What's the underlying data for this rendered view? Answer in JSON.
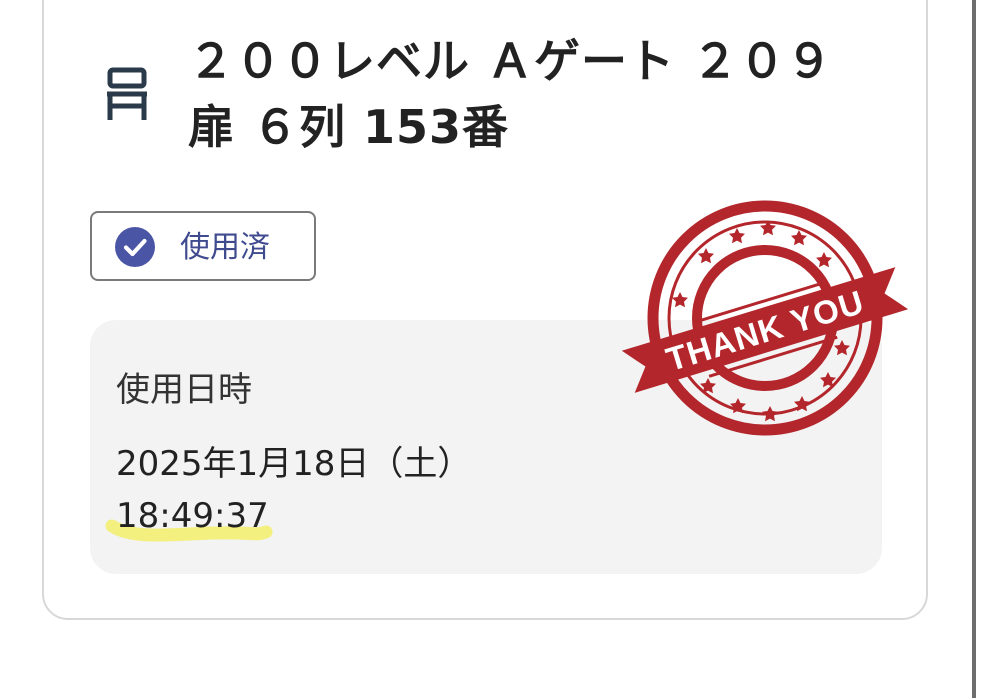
{
  "seat": {
    "title_line1": "２００レベル Ａゲート ２０９",
    "title_line2": "扉 ６列 153番",
    "icon": "seat-icon"
  },
  "status": {
    "label": "使用済",
    "icon": "check-circle-icon",
    "icon_color": "#4b55a6"
  },
  "usage": {
    "label": "使用日時",
    "date": "2025年1月18日（土）",
    "time": "18:49:37",
    "highlight_color": "#f2ef6a"
  },
  "stamp": {
    "text": "THANK YOU",
    "color": "#b3262b"
  }
}
